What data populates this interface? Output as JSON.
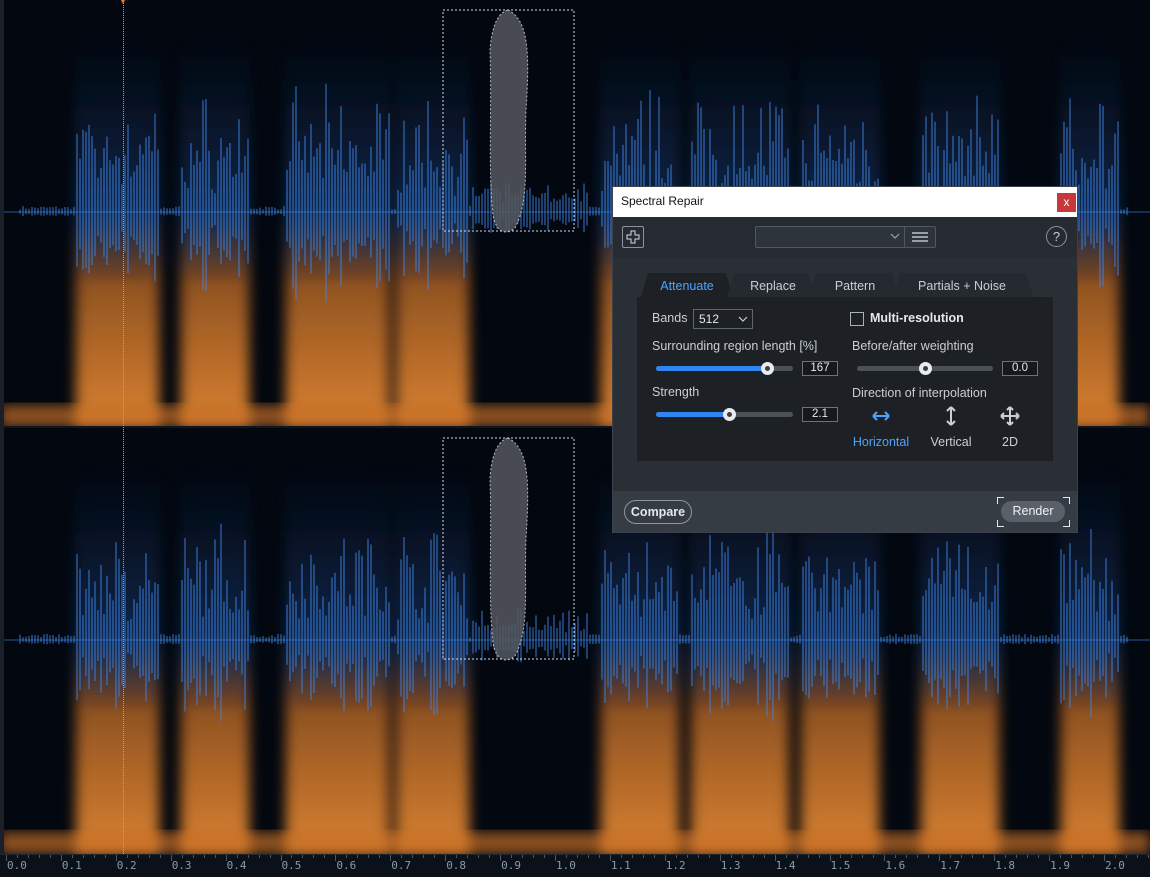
{
  "timeline": {
    "ticks": [
      "0.0",
      "0.1",
      "0.2",
      "0.3",
      "0.4",
      "0.5",
      "0.6",
      "0.7",
      "0.8",
      "0.9",
      "1.0",
      "1.1",
      "1.2",
      "1.3",
      "1.4",
      "1.5",
      "1.6",
      "1.7",
      "1.8",
      "1.9",
      "2.0"
    ]
  },
  "colors": {
    "waveform": "#3d86e6",
    "spectrum_low": "#e07a2a",
    "spectrum_high": "#1f4f9a",
    "accent": "#4ea2ff",
    "close": "#c8383a"
  },
  "dialog": {
    "title": "Spectral Repair",
    "close_label": "x",
    "add_icon": "plus-icon",
    "help_label": "?",
    "tabs": [
      {
        "label": "Attenuate",
        "active": true
      },
      {
        "label": "Replace",
        "active": false
      },
      {
        "label": "Pattern",
        "active": false
      },
      {
        "label": "Partials + Noise",
        "active": false
      }
    ],
    "bands": {
      "label": "Bands",
      "value": "512"
    },
    "multi_resolution": {
      "label": "Multi-resolution",
      "checked": false
    },
    "surrounding": {
      "label": "Surrounding region length [%]",
      "value": "167",
      "fraction": 0.81
    },
    "weighting": {
      "label": "Before/after weighting",
      "value": "0.0",
      "fraction": 0.5
    },
    "strength": {
      "label": "Strength",
      "value": "2.1",
      "fraction": 0.53
    },
    "direction": {
      "label": "Direction of interpolation",
      "options": [
        {
          "label": "Horizontal",
          "icon": "horizontal-arrows-icon",
          "active": true
        },
        {
          "label": "Vertical",
          "icon": "vertical-arrows-icon",
          "active": false
        },
        {
          "label": "2D",
          "icon": "move-arrows-icon",
          "active": false
        }
      ]
    },
    "compare_label": "Compare",
    "render_label": "Render"
  }
}
